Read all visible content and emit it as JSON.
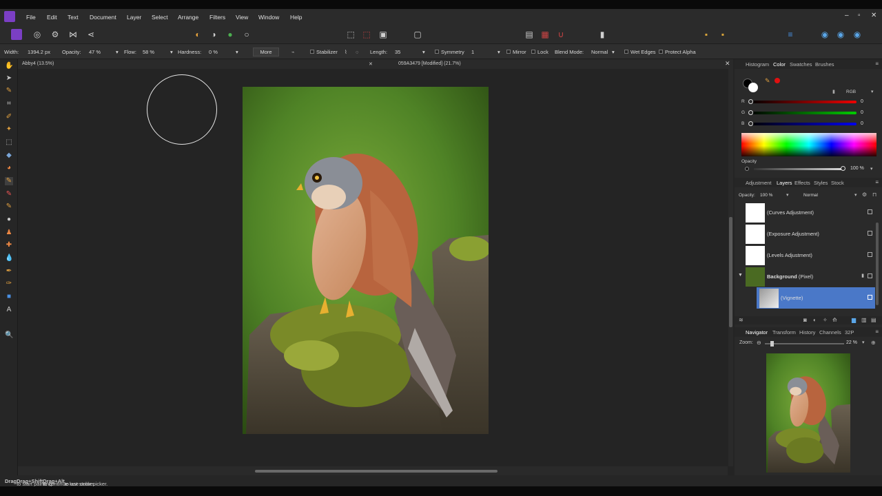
{
  "menu": {
    "items": [
      "File",
      "Edit",
      "Text",
      "Document",
      "Layer",
      "Select",
      "Arrange",
      "Filters",
      "View",
      "Window",
      "Help"
    ]
  },
  "context": {
    "width_label": "Width:",
    "width_value": "1394.2 px",
    "opacity_label": "Opacity:",
    "opacity_value": "47 %",
    "flow_label": "Flow:",
    "flow_value": "58 %",
    "hardness_label": "Hardness:",
    "hardness_value": "0 %",
    "more": "More",
    "stabilizer": "Stabilizer",
    "length_label": "Length:",
    "length_value": "35",
    "symmetry": "Symmetry",
    "symmetry_value": "1",
    "mirror": "Mirror",
    "lock": "Lock",
    "blend_label": "Blend Mode:",
    "blend_value": "Normal",
    "wet_edges": "Wet Edges",
    "protect_alpha": "Protect Alpha"
  },
  "tabs": {
    "first": "Abby4 (13.5%)",
    "second": "059A3479 [Modified] (21.7%)"
  },
  "status": {
    "p1": "Drag",
    "p2": " to start painting. ",
    "p3": "Drag+Shift",
    "p4": " to continue last stroke. ",
    "p5": "Drag+Alt",
    "p6": " to use color picker."
  },
  "color_panel": {
    "tabs": [
      "Histogram",
      "Color",
      "Swatches",
      "Brushes"
    ],
    "active": "Color",
    "mode": "RGB",
    "r_label": "R",
    "g_label": "G",
    "b_label": "B",
    "r": "0",
    "g": "0",
    "b": "0",
    "opacity_label": "Opacity",
    "opacity_value": "100 %"
  },
  "layers_panel": {
    "tabs": [
      "Adjustment",
      "Layers",
      "Effects",
      "Styles",
      "Stock"
    ],
    "active": "Layers",
    "opacity_label": "Opacity:",
    "opacity_value": "100 %",
    "blend": "Normal",
    "layers": [
      "(Curves Adjustment)",
      "(Exposure Adjustment)",
      "(Levels Adjustment)"
    ],
    "background_name": "Background",
    "background_type": "(Pixel)",
    "vignette": "(Vignette)"
  },
  "navigator_panel": {
    "tabs": [
      "Navigator",
      "Transform",
      "History",
      "Channels",
      "32P"
    ],
    "active": "Navigator",
    "zoom_label": "Zoom:",
    "zoom_value": "22 %"
  },
  "colors": {
    "accent": "#4a78c8",
    "photo_bg": "#5a8a2a"
  }
}
